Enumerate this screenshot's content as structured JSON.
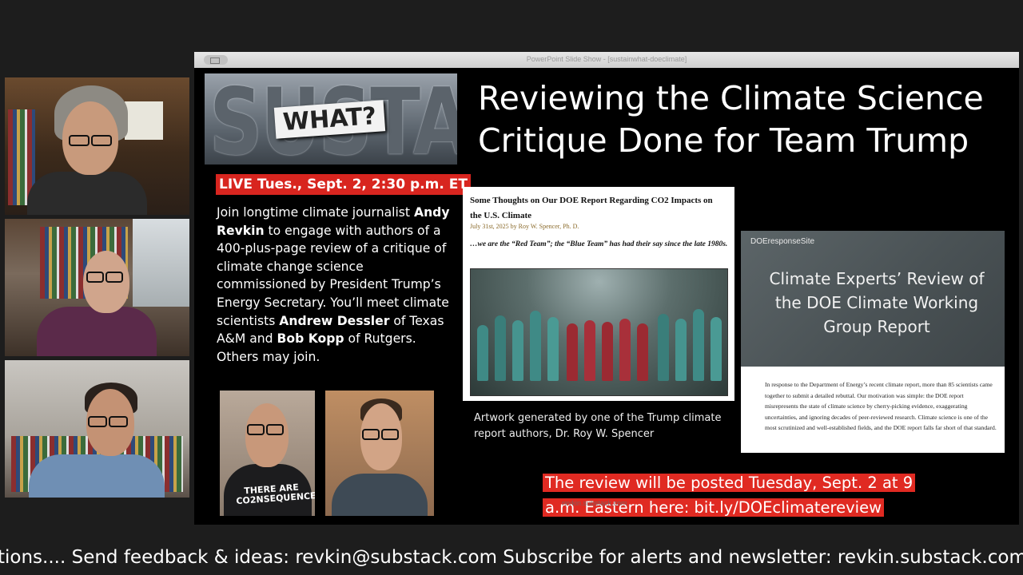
{
  "window": {
    "title": "PowerPoint Slide Show - [sustainwhat-doeclimate]"
  },
  "participants": [
    {
      "name": "participant-1"
    },
    {
      "name": "participant-2"
    },
    {
      "name": "participant-3"
    }
  ],
  "slide": {
    "logo_main": "SUSTAIN",
    "logo_overlay": "WHAT?",
    "title_line1": "Reviewing the Climate Science",
    "title_line2": "Critique Done for Team Trump",
    "live_banner": "LIVE Tues., Sept. 2, 2:30 p.m. ET",
    "intro": {
      "part1": "Join longtime climate journalist ",
      "name1": "Andy Revkin",
      "part2": " to engage with authors of a 400-plus-page review of a critique of climate change science commissioned by President Trump’s Energy Secretary. You’ll meet climate scientists ",
      "name2": "Andrew Dessler",
      "part3": " of Texas A&M and ",
      "name3": "Bob Kopp",
      "part4": " of Rutgers. Others may join."
    },
    "shirt_text": "THERE ARE CO2NSEQUENCES",
    "doe_card": {
      "title": "Some Thoughts on Our DOE Report Regarding CO2 Impacts on the U.S. Climate",
      "byline": "July 31st, 2025 by Roy W. Spencer, Ph. D.",
      "quote": "…we are the “Red Team”; the “Blue Team” has had their say since the late 1980s."
    },
    "art_caption": "Artwork generated by one of the Trump climate report authors, Dr. Roy W. Spencer",
    "review_card": {
      "site": "DOEresponseSite",
      "heading": "Climate Experts’ Review of the DOE Climate Working Group Report",
      "body": "In response to the Department of Energy’s recent climate report, more than 85 scientists came together to submit a detailed rebuttal. Our motivation was simple: the DOE report misrepresents the state of climate science by cherry-picking evidence, exaggerating uncertainties, and ignoring decades of peer-reviewed research. Climate science is one of the most scrutinized and well-established fields, and the DOE report falls far short of that standard."
    },
    "posted_banner": "The review will be posted Tuesday, Sept. 2 at 9 a.m. Eastern here: bit.ly/DOEclimatereview",
    "ghost_url": "revkin.substack.com"
  },
  "ticker": "tions.... Send feedback & ideas: revkin@substack.com Subscribe for alerts and newsletter: revkin.substack.com"
}
